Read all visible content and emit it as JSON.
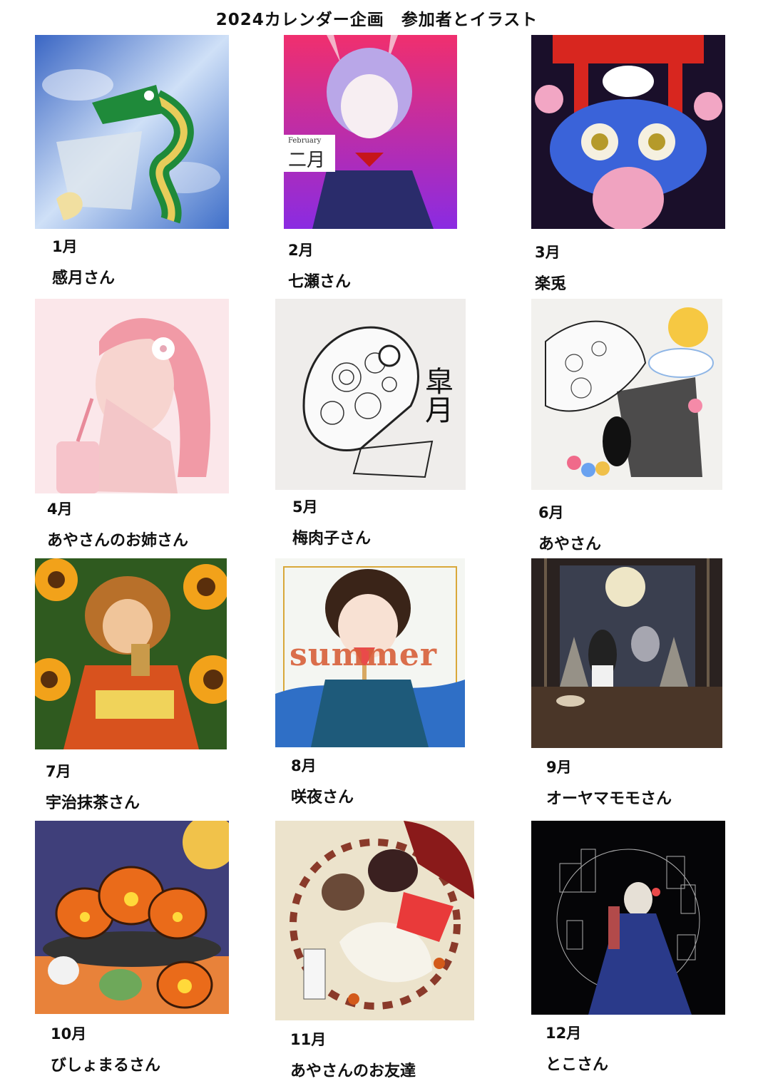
{
  "title": "2024カレンダー企画　参加者とイラスト",
  "entries": [
    {
      "month": "1月",
      "participant": "感月さん",
      "art_icon": "dragon-illustration-icon"
    },
    {
      "month": "2月",
      "participant": "七瀬さん",
      "art_icon": "oni-character-illustration-icon",
      "art_caption_top": "February",
      "art_caption_main": "二月"
    },
    {
      "month": "3月",
      "participant": "楽兎",
      "art_icon": "blue-frog-dragon-illustration-icon"
    },
    {
      "month": "4月",
      "participant": "あやさんのお姉さん",
      "art_icon": "pink-girl-drinking-illustration-icon"
    },
    {
      "month": "5月",
      "participant": "梅肉子さん",
      "art_icon": "zentangle-fish-illustration-icon",
      "art_caption_main": "皐月"
    },
    {
      "month": "6月",
      "participant": "あやさん",
      "art_icon": "zentangle-umbrella-cat-illustration-icon"
    },
    {
      "month": "7月",
      "participant": "宇治抹茶さん",
      "art_icon": "sunflower-yukata-girl-illustration-icon"
    },
    {
      "month": "8月",
      "participant": "咲夜さん",
      "art_icon": "summer-watermelon-popsicle-girl-illustration-icon",
      "art_caption_main": "summer"
    },
    {
      "month": "9月",
      "participant": "オーヤマモモさん",
      "art_icon": "moon-viewing-children-illustration-icon"
    },
    {
      "month": "10月",
      "participant": "びしょまるさん",
      "art_icon": "halloween-pumpkins-illustration-icon"
    },
    {
      "month": "11月",
      "participant": "あやさんのお友達",
      "art_icon": "autumn-squirrel-girl-illustration-icon"
    },
    {
      "month": "12月",
      "participant": "とこさん",
      "art_icon": "night-city-dress-girl-illustration-icon"
    }
  ],
  "colors": {
    "background": "#ffffff",
    "text": "#111111"
  }
}
